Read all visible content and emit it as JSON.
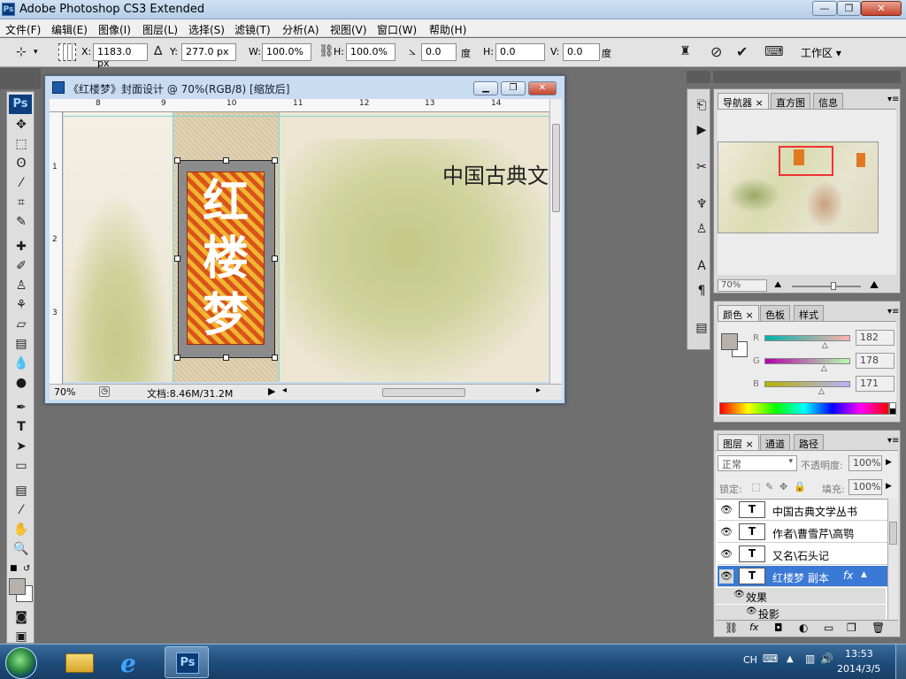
{
  "app": {
    "title": "Adobe Photoshop CS3 Extended",
    "badge": "Ps"
  },
  "window_buttons": {
    "min": "—",
    "max": "❐",
    "close": "✕"
  },
  "menu": [
    "文件(F)",
    "编辑(E)",
    "图像(I)",
    "图层(L)",
    "选择(S)",
    "滤镜(T)",
    "分析(A)",
    "视图(V)",
    "窗口(W)",
    "帮助(H)"
  ],
  "options": {
    "x_label": "X:",
    "x_value": "1183.0 px",
    "y_label": "Y:",
    "y_value": "277.0 px",
    "w_label": "W:",
    "w_value": "100.0%",
    "h_label": "H:",
    "h_value": "100.0%",
    "angle_value": "0.0",
    "angle_unit": "度",
    "hskew_label": "H:",
    "hskew_value": "0.0",
    "vskew_label": "V:",
    "vskew_value": "0.0",
    "skew_unit": "度",
    "workspace_label": "工作区 ▾"
  },
  "toolbox": {
    "logo": "Ps"
  },
  "document": {
    "title": "《红楼梦》封面设计 @ 70%(RGB/8) [缩放后]",
    "ruler_top": [
      "8",
      "9",
      "10",
      "11",
      "12",
      "13",
      "14"
    ],
    "ruler_left": [
      "1",
      "2",
      "3"
    ],
    "canvas_title_chars": [
      "红",
      "楼",
      "梦"
    ],
    "canvas_text": "中国古典文",
    "zoom": "70%",
    "doc_size": "文档:8.46M/31.2M"
  },
  "navigator": {
    "tabs": [
      "导航器",
      "直方图",
      "信息"
    ],
    "zoom": "70%"
  },
  "color_panel": {
    "tabs": [
      "颜色",
      "色板",
      "样式"
    ],
    "r_label": "R",
    "r_value": "182",
    "g_label": "G",
    "g_value": "178",
    "b_label": "B",
    "b_value": "171",
    "r_level": 0.71,
    "g_level": 0.7,
    "b_level": 0.67,
    "fg_color": "#b6b2ab"
  },
  "layers_panel": {
    "tabs": [
      "图层",
      "通道",
      "路径"
    ],
    "blend_mode": "正常",
    "opacity_label": "不透明度:",
    "opacity_value": "100%",
    "lock_label": "锁定:",
    "fill_label": "填充:",
    "fill_value": "100%",
    "layers": [
      {
        "name": "中国古典文学丛书",
        "type": "T"
      },
      {
        "name": "作者\\曹雪芹\\高鹗",
        "type": "T"
      },
      {
        "name": "又名\\石头记",
        "type": "T"
      },
      {
        "name": "红楼梦 副本",
        "type": "T",
        "fx": "fx"
      }
    ],
    "effects_label": "效果",
    "effect_item": "投影"
  },
  "taskbar": {
    "lang": "CH",
    "time": "13:53",
    "date": "2014/3/5"
  }
}
